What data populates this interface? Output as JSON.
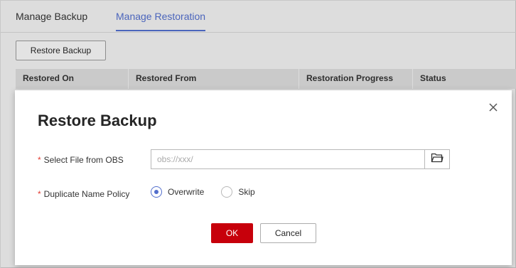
{
  "tabs": [
    {
      "label": "Manage Backup",
      "active": false
    },
    {
      "label": "Manage Restoration",
      "active": true
    }
  ],
  "toolbar": {
    "restore_label": "Restore Backup"
  },
  "table": {
    "columns": [
      "Restored On",
      "Restored From",
      "Restoration Progress",
      "Status"
    ]
  },
  "dialog": {
    "title": "Restore Backup",
    "close_icon": "close-icon",
    "fields": {
      "obs_file": {
        "required_mark": "*",
        "label": "Select File from OBS",
        "placeholder": "obs://xxx/",
        "value": "",
        "button_icon": "folder-icon"
      },
      "duplicate_policy": {
        "required_mark": "*",
        "label": "Duplicate Name Policy",
        "options": [
          "Overwrite",
          "Skip"
        ],
        "selected": "Overwrite"
      }
    },
    "ok_label": "OK",
    "cancel_label": "Cancel"
  },
  "colors": {
    "accent": "#526ecc",
    "primary_button": "#c7000b",
    "required": "#e33b32"
  }
}
